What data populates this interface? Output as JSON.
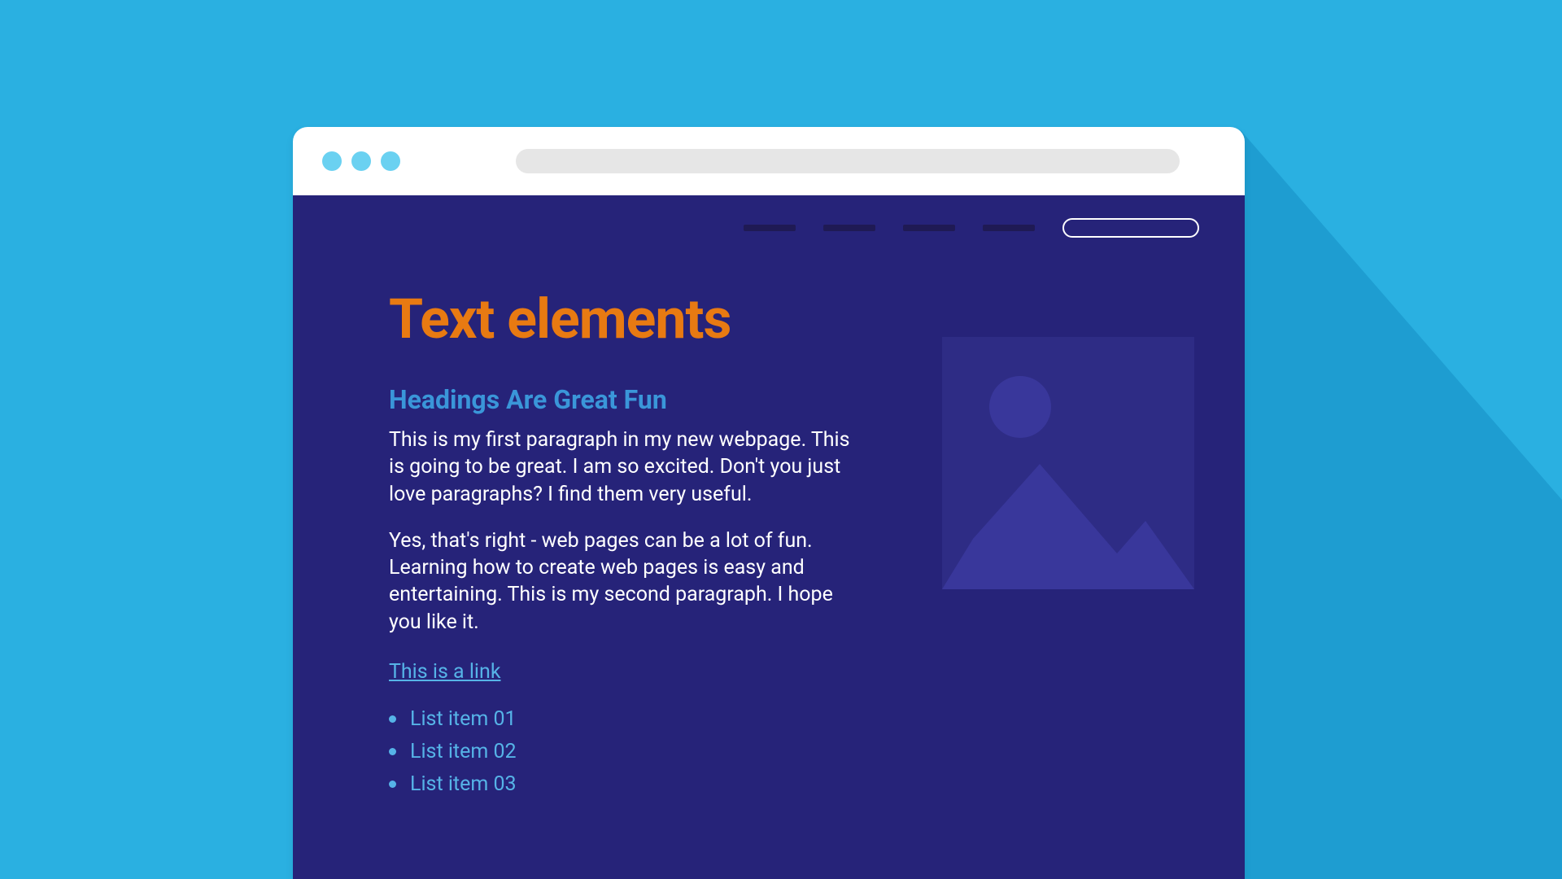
{
  "content": {
    "title": "Text elements",
    "subheading": "Headings Are Great Fun",
    "paragraph1": "This is my first paragraph in my new webpage. This is going to be great. I am so excited. Don't you just love paragraphs? I find them very useful.",
    "paragraph2": "Yes, that's right - web pages can be a lot of fun. Learning how to create web pages is easy and entertaining. This is my second paragraph. I hope you like it.",
    "link_text": "This is a link",
    "list_items": [
      "List item 01",
      "List item 02",
      "List item 03"
    ]
  },
  "colors": {
    "background": "#2AB0E1",
    "page_bg": "#262379",
    "title": "#E87A12",
    "accent": "#56B3E7"
  }
}
